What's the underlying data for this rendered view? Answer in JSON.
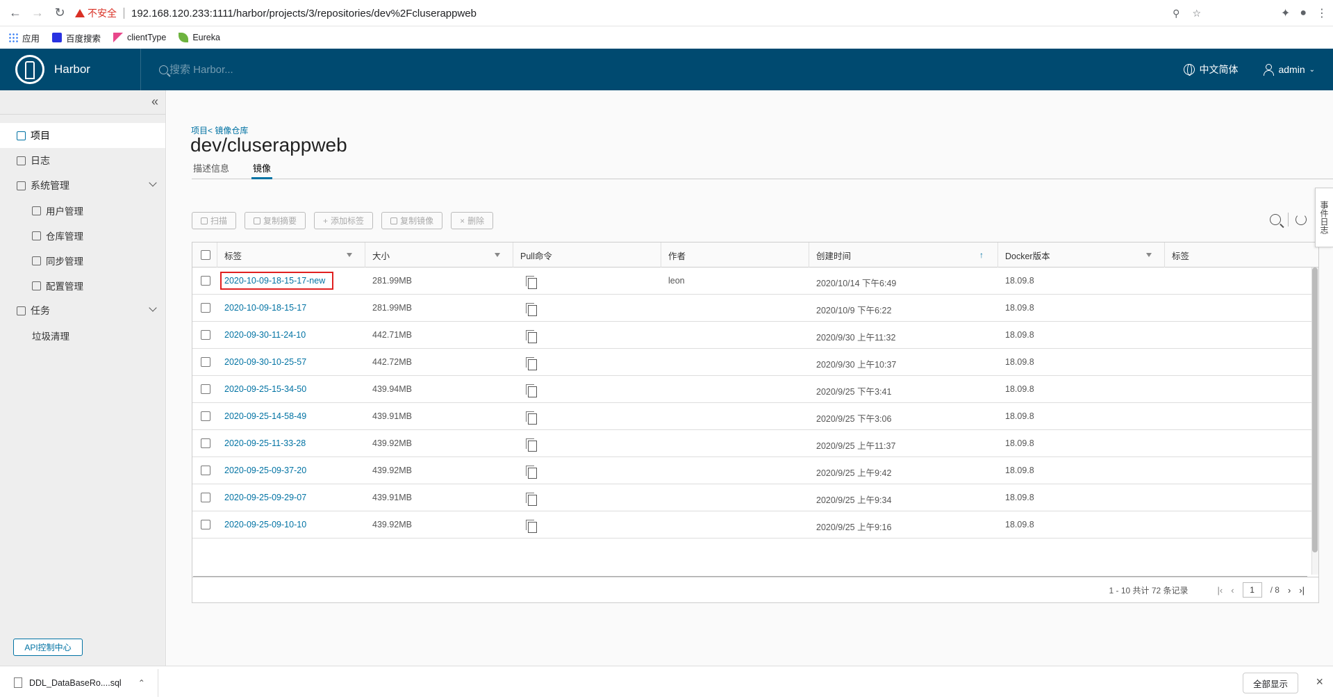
{
  "browser": {
    "security_label": "不安全",
    "url": "192.168.120.233:1111/harbor/projects/3/repositories/dev%2Fcluserappweb",
    "bookmarks": [
      {
        "label": "应用",
        "icon": "apps-grid-icon"
      },
      {
        "label": "百度搜索",
        "icon": "baidu-paw-icon"
      },
      {
        "label": "clientType",
        "icon": "kibana-icon"
      },
      {
        "label": "Eureka",
        "icon": "spring-leaf-icon"
      }
    ]
  },
  "header": {
    "app_name": "Harbor",
    "search_placeholder": "搜索 Harbor...",
    "language": "中文简体",
    "user": "admin"
  },
  "sidebar": {
    "items": [
      {
        "label": "项目",
        "active": true
      },
      {
        "label": "日志"
      },
      {
        "label": "系统管理"
      },
      {
        "label": "用户管理"
      },
      {
        "label": "仓库管理"
      },
      {
        "label": "同步管理"
      },
      {
        "label": "配置管理"
      },
      {
        "label": "任务"
      },
      {
        "label": "垃圾清理"
      }
    ],
    "api_button": "API控制中心"
  },
  "main": {
    "breadcrumb": "项目< 镜像仓库",
    "title": "dev/cluserappweb",
    "tabs": [
      "描述信息",
      "镜像"
    ],
    "active_tab": "镜像",
    "toolbar": [
      "扫描",
      "复制摘要",
      "添加标签",
      "复制镜像",
      "删除"
    ],
    "table": {
      "columns": [
        "标签",
        "大小",
        "Pull命令",
        "作者",
        "创建时间",
        "Docker版本",
        "标签"
      ],
      "rows": [
        {
          "tag": "2020-10-09-18-15-17-new",
          "size": "281.99MB",
          "author": "leon",
          "created": "2020/10/14 下午6:49",
          "docker": "18.09.8",
          "highlighted": true
        },
        {
          "tag": "2020-10-09-18-15-17",
          "size": "281.99MB",
          "author": "",
          "created": "2020/10/9 下午6:22",
          "docker": "18.09.8"
        },
        {
          "tag": "2020-09-30-11-24-10",
          "size": "442.71MB",
          "author": "",
          "created": "2020/9/30 上午11:32",
          "docker": "18.09.8"
        },
        {
          "tag": "2020-09-30-10-25-57",
          "size": "442.72MB",
          "author": "",
          "created": "2020/9/30 上午10:37",
          "docker": "18.09.8"
        },
        {
          "tag": "2020-09-25-15-34-50",
          "size": "439.94MB",
          "author": "",
          "created": "2020/9/25 下午3:41",
          "docker": "18.09.8"
        },
        {
          "tag": "2020-09-25-14-58-49",
          "size": "439.91MB",
          "author": "",
          "created": "2020/9/25 下午3:06",
          "docker": "18.09.8"
        },
        {
          "tag": "2020-09-25-11-33-28",
          "size": "439.92MB",
          "author": "",
          "created": "2020/9/25 上午11:37",
          "docker": "18.09.8"
        },
        {
          "tag": "2020-09-25-09-37-20",
          "size": "439.92MB",
          "author": "",
          "created": "2020/9/25 上午9:42",
          "docker": "18.09.8"
        },
        {
          "tag": "2020-09-25-09-29-07",
          "size": "439.91MB",
          "author": "",
          "created": "2020/9/25 上午9:34",
          "docker": "18.09.8"
        },
        {
          "tag": "2020-09-25-09-10-10",
          "size": "439.92MB",
          "author": "",
          "created": "2020/9/25 上午9:16",
          "docker": "18.09.8"
        }
      ]
    },
    "pagination": {
      "summary": "1 - 10 共计 72 条记录",
      "current_page": "1",
      "total_pages": "/ 8"
    },
    "side_tab": "事件日志"
  },
  "download_bar": {
    "file_name": "DDL_DataBaseRo....sql",
    "show_all": "全部显示"
  },
  "colors": {
    "header_bg": "#004a70",
    "link": "#0072a3",
    "highlight_box": "#e02020"
  }
}
